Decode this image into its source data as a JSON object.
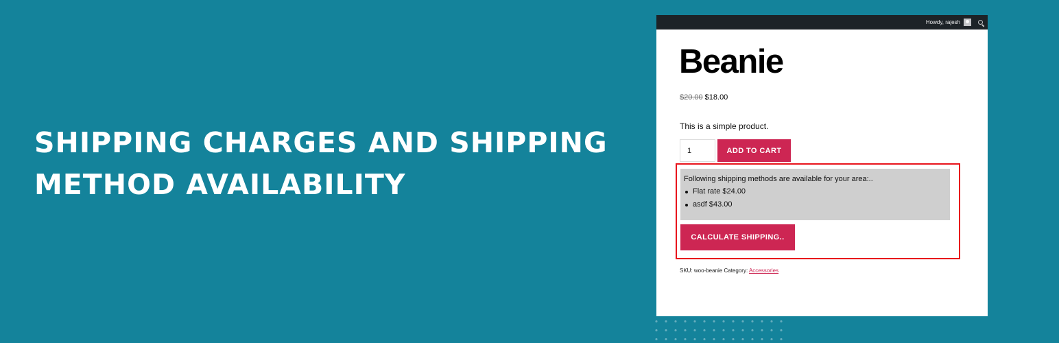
{
  "banner": {
    "headline_line1": "SHIPPING CHARGES AND SHIPPING",
    "headline_line2": "METHOD AVAILABILITY"
  },
  "colors": {
    "background": "#14839b",
    "accent": "#cd2653",
    "highlight_border": "#e8141c",
    "admin_bar": "#1d2327"
  },
  "admin_bar": {
    "greeting": "Howdy, rajesh",
    "icons": [
      "avatar",
      "search-icon"
    ]
  },
  "product": {
    "title": "Beanie",
    "old_price": "$20.00",
    "price": "$18.00",
    "description": "This is a simple product.",
    "quantity": "1",
    "add_to_cart_label": "ADD TO CART"
  },
  "shipping": {
    "intro": "Following shipping methods are available for your area:..",
    "methods": [
      "Flat rate $24.00",
      "asdf $43.00"
    ],
    "calculate_label": "CALCULATE SHIPPING.."
  },
  "meta": {
    "sku_text": "SKU: woo-beanie Category:",
    "category_link": "Accessories"
  }
}
